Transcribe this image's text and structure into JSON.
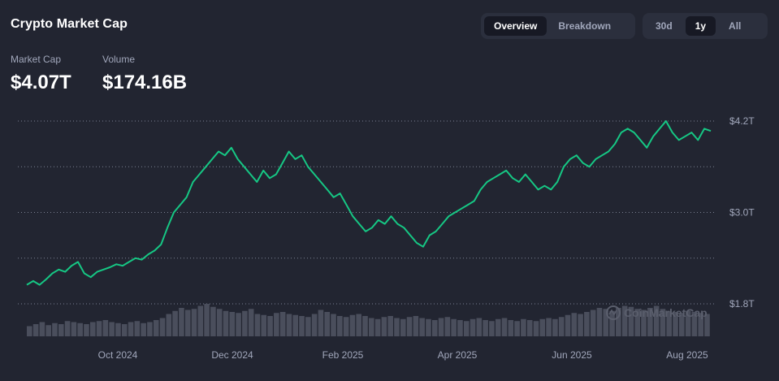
{
  "header": {
    "title": "Crypto Market Cap",
    "market_cap_label": "Market Cap",
    "market_cap_value": "$4.07T",
    "volume_label": "Volume",
    "volume_value": "$174.16B"
  },
  "view_tabs": [
    {
      "label": "Overview",
      "active": true
    },
    {
      "label": "Breakdown",
      "active": false
    }
  ],
  "range_tabs": [
    {
      "label": "30d",
      "active": false
    },
    {
      "label": "1y",
      "active": true
    },
    {
      "label": "All",
      "active": false
    }
  ],
  "watermark": "CoinMarketCap",
  "colors": {
    "line": "#16c784",
    "volume": "#4a4e5c",
    "grid": "#a1a7bb"
  },
  "chart_data": {
    "type": "line",
    "x_tick_labels": [
      "Oct 2024",
      "Dec 2024",
      "Feb 2025",
      "Apr 2025",
      "Jun 2025",
      "Aug 2025"
    ],
    "y_tick_labels": [
      "$1.8T",
      "$3.0T",
      "$4.2T"
    ],
    "ylim": [
      1.8,
      4.2
    ],
    "y_unit": "T USD",
    "grid": true,
    "x_start": "Aug 2024",
    "x_end": "Aug 2025",
    "series": [
      {
        "kind": "market_cap",
        "values": [
          2.05,
          2.1,
          2.05,
          2.12,
          2.2,
          2.25,
          2.22,
          2.3,
          2.35,
          2.2,
          2.15,
          2.22,
          2.25,
          2.28,
          2.32,
          2.3,
          2.35,
          2.4,
          2.38,
          2.45,
          2.5,
          2.58,
          2.8,
          3.0,
          3.1,
          3.2,
          3.4,
          3.5,
          3.6,
          3.7,
          3.8,
          3.75,
          3.85,
          3.7,
          3.6,
          3.5,
          3.4,
          3.55,
          3.45,
          3.5,
          3.65,
          3.8,
          3.7,
          3.75,
          3.6,
          3.5,
          3.4,
          3.3,
          3.2,
          3.25,
          3.1,
          2.95,
          2.85,
          2.75,
          2.8,
          2.9,
          2.85,
          2.95,
          2.85,
          2.8,
          2.7,
          2.6,
          2.55,
          2.7,
          2.75,
          2.85,
          2.95,
          3.0,
          3.05,
          3.1,
          3.15,
          3.3,
          3.4,
          3.45,
          3.5,
          3.55,
          3.45,
          3.4,
          3.5,
          3.4,
          3.3,
          3.35,
          3.3,
          3.4,
          3.6,
          3.7,
          3.75,
          3.65,
          3.6,
          3.7,
          3.75,
          3.8,
          3.9,
          4.05,
          4.1,
          4.05,
          3.95,
          3.85,
          4.0,
          4.1,
          4.2,
          4.05,
          3.95,
          4.0,
          4.05,
          3.95,
          4.1,
          4.07
        ]
      },
      {
        "kind": "volume",
        "values": [
          0.1,
          0.12,
          0.14,
          0.11,
          0.13,
          0.12,
          0.15,
          0.14,
          0.13,
          0.12,
          0.14,
          0.15,
          0.16,
          0.14,
          0.13,
          0.12,
          0.14,
          0.15,
          0.13,
          0.14,
          0.16,
          0.18,
          0.22,
          0.25,
          0.28,
          0.26,
          0.27,
          0.3,
          0.32,
          0.29,
          0.27,
          0.25,
          0.24,
          0.23,
          0.25,
          0.27,
          0.22,
          0.21,
          0.2,
          0.23,
          0.24,
          0.22,
          0.21,
          0.2,
          0.19,
          0.22,
          0.26,
          0.24,
          0.22,
          0.2,
          0.19,
          0.21,
          0.22,
          0.2,
          0.18,
          0.17,
          0.19,
          0.2,
          0.18,
          0.17,
          0.19,
          0.2,
          0.18,
          0.17,
          0.16,
          0.18,
          0.19,
          0.17,
          0.16,
          0.15,
          0.17,
          0.18,
          0.16,
          0.15,
          0.17,
          0.18,
          0.16,
          0.15,
          0.17,
          0.16,
          0.15,
          0.17,
          0.18,
          0.17,
          0.19,
          0.21,
          0.23,
          0.22,
          0.24,
          0.26,
          0.28,
          0.27,
          0.25,
          0.28,
          0.3,
          0.29,
          0.27,
          0.26,
          0.28,
          0.3,
          0.27,
          0.25,
          0.24,
          0.23,
          0.25,
          0.24,
          0.23,
          0.22
        ]
      }
    ]
  }
}
